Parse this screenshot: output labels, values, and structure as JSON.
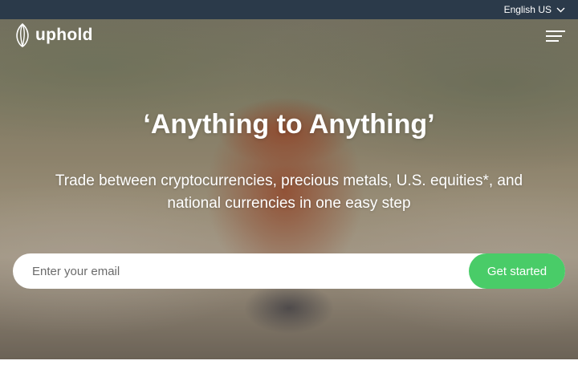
{
  "topbar": {
    "language_label": "English US",
    "language_icon": "chevron-down-icon"
  },
  "nav": {
    "brand_name": "uphold",
    "logo_icon": "uphold-logo-icon",
    "menu_icon": "hamburger-menu-icon"
  },
  "hero": {
    "title": "‘Anything to Anything’",
    "subtitle": "Trade between cryptocurrencies, precious metals, U.S. equities*, and national currencies in one easy step"
  },
  "signup": {
    "email_placeholder": "Enter your email",
    "email_value": "",
    "cta_label": "Get started"
  },
  "colors": {
    "topbar_bg": "#2b3a4a",
    "cta_bg": "#49cc68",
    "text_on_hero": "#ffffff"
  }
}
